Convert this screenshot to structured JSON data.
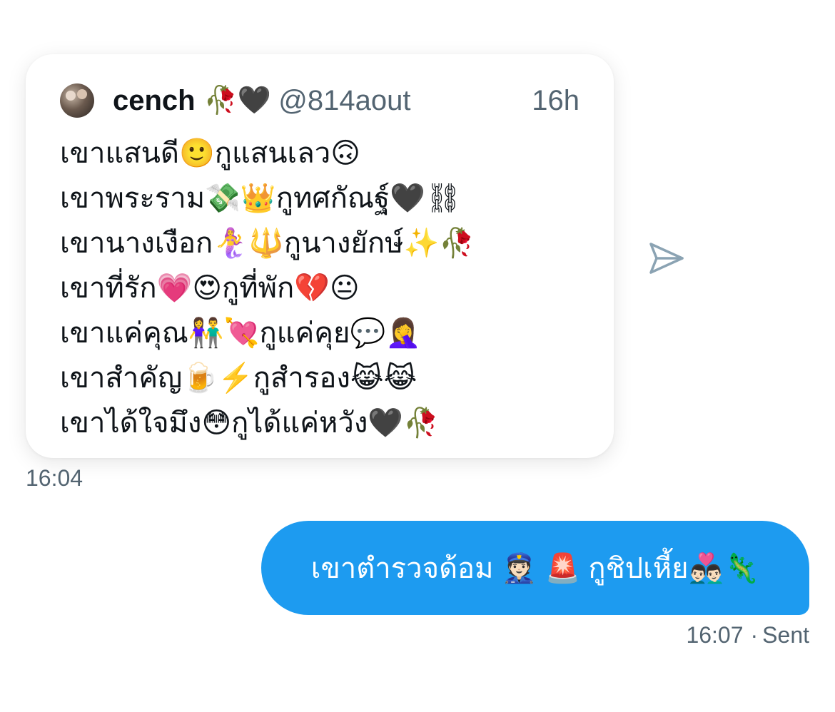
{
  "quote": {
    "author": {
      "display_name": "cench",
      "display_emoji": "🥀🖤",
      "handle": "@814aout"
    },
    "relative_time": "16h",
    "lines": [
      "เขาแสนดี🙂กูแสนเลว🙃",
      "เขาพระราม💸👑กูทศกัณฐ์🖤⛓",
      "เขานางเงือก🧜‍♀️🔱กูนางยักษ์✨🥀",
      "เขาที่รัก💗😍กูที่พัก💔😐",
      "เขาแค่คุณ👫💘กูแค่คุย💬🤦‍♀️",
      "เขาสำคัญ🍺⚡️กูสำรอง😹😹",
      "เขาได้ใจมึง😳กูได้แค่หวัง🖤🥀"
    ]
  },
  "received_time": "16:04",
  "sent_message": {
    "text": "เขาตำรวจด้อม 👮🏻 🚨 กูชิปเหี้ย👨🏻‍❤️‍👨🏻🦎",
    "time": "16:07",
    "dot": "·",
    "status": "Sent"
  },
  "colors": {
    "bubble_blue": "#1d9bf0",
    "secondary_text": "#536471",
    "primary_text": "#0f1419"
  },
  "icons": {
    "share": "send-arrow-icon"
  }
}
